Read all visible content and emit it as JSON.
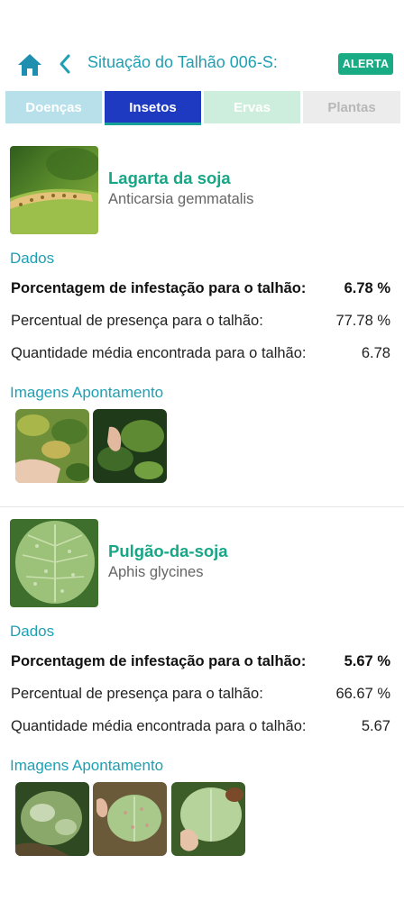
{
  "header": {
    "title": "Situação do Talhão 006-S:",
    "badge": "ALERTA"
  },
  "tabs": [
    {
      "label": "Doenças",
      "active": false
    },
    {
      "label": "Insetos",
      "active": true
    },
    {
      "label": "Ervas",
      "active": false
    },
    {
      "label": "Plantas",
      "active": false
    }
  ],
  "pests": [
    {
      "name": "Lagarta da soja",
      "scientific": "Anticarsia gemmatalis",
      "data_label": "Dados",
      "rows": [
        {
          "label": "Porcentagem de infestação para o talhão:",
          "value": "6.78 %"
        },
        {
          "label": "Percentual de presença para o talhão:",
          "value": "77.78 %"
        },
        {
          "label": "Quantidade média encontrada para o talhão:",
          "value": "6.78"
        }
      ],
      "images_label": "Imagens Apontamento"
    },
    {
      "name": "Pulgão-da-soja",
      "scientific": "Aphis glycines",
      "data_label": "Dados",
      "rows": [
        {
          "label": "Porcentagem de infestação para o talhão:",
          "value": "5.67 %"
        },
        {
          "label": "Percentual de presença para o talhão:",
          "value": "66.67 %"
        },
        {
          "label": "Quantidade média encontrada para o talhão:",
          "value": "5.67"
        }
      ],
      "images_label": "Imagens Apontamento"
    }
  ],
  "colors": {
    "accent_teal": "#1f9fb3",
    "green_name": "#17a786",
    "alert": "#18ab84",
    "active_tab": "#1e3ac0"
  }
}
